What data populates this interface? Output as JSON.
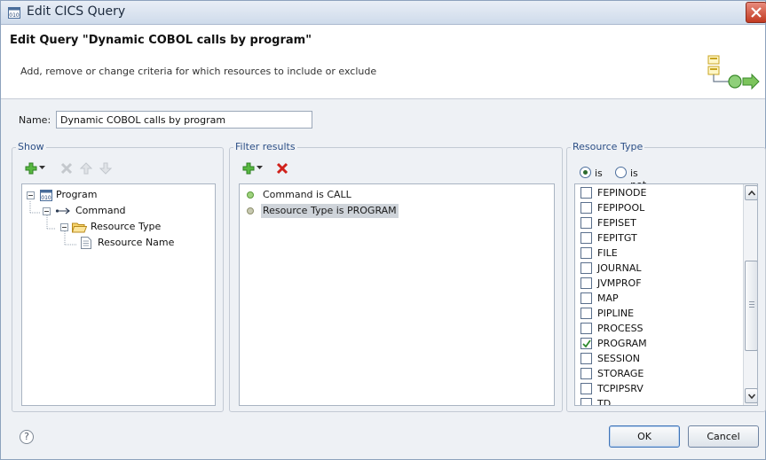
{
  "window": {
    "title": "Edit CICS Query",
    "icon": "cics-query-icon"
  },
  "header": {
    "heading": "Edit Query \"Dynamic COBOL calls by program\"",
    "description": "Add, remove or change criteria for which resources to include or exclude",
    "icon": "query-wizard-banner-icon"
  },
  "name_field": {
    "label": "Name:",
    "value": "Dynamic COBOL calls by program"
  },
  "show_panel": {
    "legend": "Show",
    "tree": [
      {
        "label": "Program",
        "icon": "program-binary-icon"
      },
      {
        "label": "Command",
        "icon": "arrow-connector-icon"
      },
      {
        "label": "Resource Type",
        "icon": "folder-icon"
      },
      {
        "label": "Resource Name",
        "icon": "document-icon"
      }
    ]
  },
  "filter_panel": {
    "legend": "Filter results",
    "items": [
      {
        "label": "Command is CALL",
        "selected": false
      },
      {
        "label": "Resource Type is PROGRAM",
        "selected": true
      }
    ]
  },
  "resource_type_panel": {
    "legend": "Resource Type",
    "radio_is": "is",
    "radio_is_not": "is not",
    "selected_radio": "is",
    "items": [
      {
        "label": "FEPINODE",
        "checked": false
      },
      {
        "label": "FEPIPOOL",
        "checked": false
      },
      {
        "label": "FEPISET",
        "checked": false
      },
      {
        "label": "FEPITGT",
        "checked": false
      },
      {
        "label": "FILE",
        "checked": false
      },
      {
        "label": "JOURNAL",
        "checked": false
      },
      {
        "label": "JVMPROF",
        "checked": false
      },
      {
        "label": "MAP",
        "checked": false
      },
      {
        "label": "PIPLINE",
        "checked": false
      },
      {
        "label": "PROCESS",
        "checked": false
      },
      {
        "label": "PROGRAM",
        "checked": true
      },
      {
        "label": "SESSION",
        "checked": false
      },
      {
        "label": "STORAGE",
        "checked": false
      },
      {
        "label": "TCPIPSRV",
        "checked": false
      },
      {
        "label": "TD",
        "checked": false
      }
    ]
  },
  "footer": {
    "help": "?",
    "ok_label": "OK",
    "cancel_label": "Cancel"
  },
  "colors": {
    "legend_text": "#2c4f86",
    "add_green": "#3a9a2c",
    "delete_red": "#d0211b",
    "selection": "#cfd4da"
  }
}
